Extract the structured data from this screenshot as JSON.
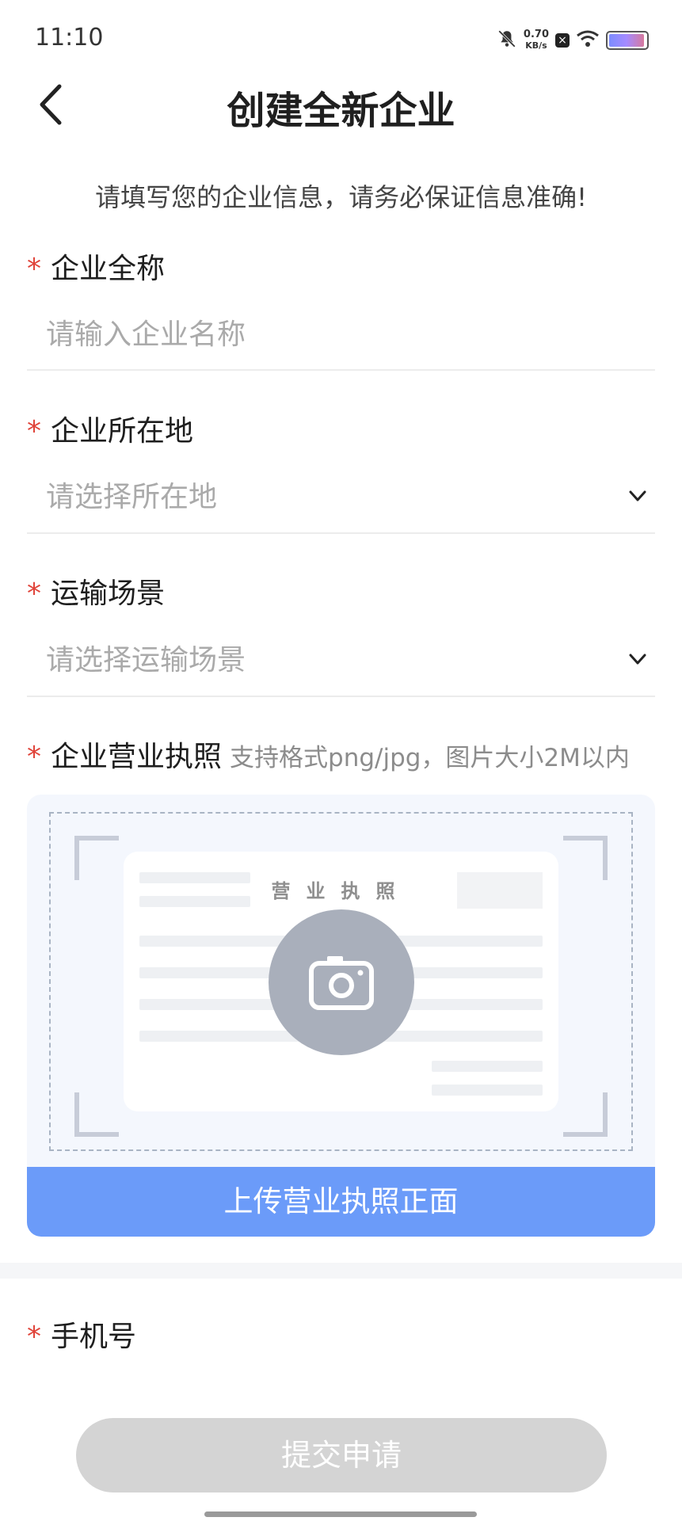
{
  "status_bar": {
    "time": "11:10",
    "speed_value": "0.70",
    "speed_unit": "KB/s",
    "icons": [
      "mute-bell-icon",
      "close-box-icon",
      "wifi-icon",
      "battery-icon"
    ]
  },
  "header": {
    "title": "创建全新企业",
    "back_icon": "chevron-left-icon"
  },
  "intro_text": "请填写您的企业信息，请务必保证信息准确!",
  "form": {
    "required_mark": "*",
    "company_name": {
      "label": "企业全称",
      "placeholder": "请输入企业名称"
    },
    "location": {
      "label": "企业所在地",
      "placeholder": "请选择所在地"
    },
    "transport_scene": {
      "label": "运输场景",
      "placeholder": "请选择运输场景"
    },
    "license": {
      "label": "企业营业执照",
      "hint": "支持格式png/jpg，图片大小2M以内",
      "doc_title": "营业执照",
      "upload_button": "上传营业执照正面",
      "camera_icon": "camera-icon"
    },
    "phone": {
      "label": "手机号"
    }
  },
  "submit_button": "提交申请",
  "colors": {
    "required": "#e0443a",
    "upload_button": "#6b9bf9",
    "submit_disabled": "#d4d4d4",
    "placeholder": "#aaaaaa"
  }
}
